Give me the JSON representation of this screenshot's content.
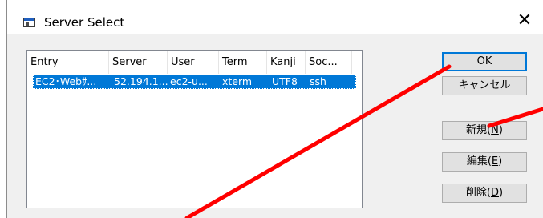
{
  "window": {
    "title": "Server Select",
    "close_glyph": "✕"
  },
  "list": {
    "columns": [
      "Entry",
      "Server",
      "User",
      "Term",
      "Kanji",
      "Soc..."
    ],
    "rows": [
      {
        "entry": "EC2･Webｻ...",
        "server": "52.194.1...",
        "user": "ec2-u...",
        "term": "xterm",
        "kanji": "UTF8",
        "soc": "ssh",
        "selected": true
      }
    ]
  },
  "buttons": {
    "ok": "OK",
    "cancel": "キャンセル",
    "new_text": "新規(",
    "new_key": "N",
    "new_close": ")",
    "edit_text": "編集(",
    "edit_key": "E",
    "edit_close": ")",
    "delete_text": "削除(",
    "delete_key": "D",
    "delete_close": ")"
  },
  "colors": {
    "selection": "#0078d7",
    "default_button_border": "#0078d7",
    "annotation": "#ff0000"
  },
  "icons": {
    "app": "window-icon",
    "close": "close-icon"
  }
}
